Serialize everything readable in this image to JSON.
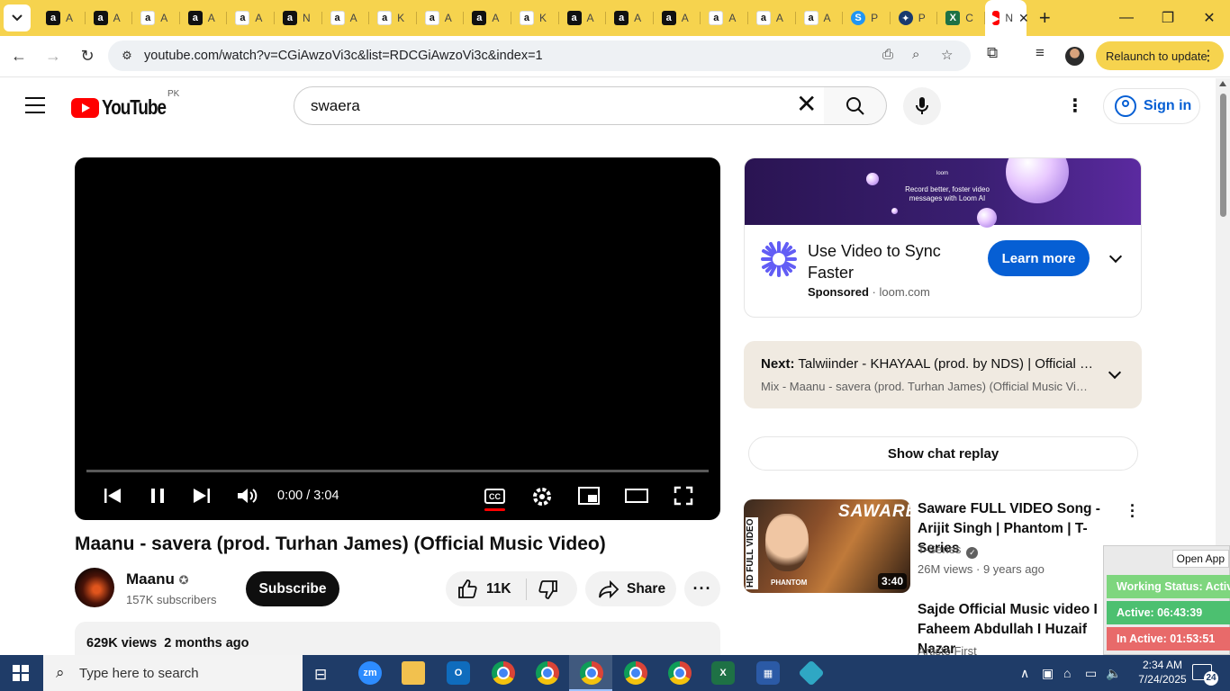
{
  "browser": {
    "tabs": [
      {
        "icon": "amazon-black",
        "label": "A"
      },
      {
        "icon": "amazon-black",
        "label": "A"
      },
      {
        "icon": "amazon-white",
        "label": "A"
      },
      {
        "icon": "amazon-black",
        "label": "A"
      },
      {
        "icon": "amazon-white",
        "label": "A"
      },
      {
        "icon": "amazon-black",
        "label": "N"
      },
      {
        "icon": "amazon-white",
        "label": "A"
      },
      {
        "icon": "amazon-white",
        "label": "K"
      },
      {
        "icon": "amazon-white",
        "label": "A"
      },
      {
        "icon": "amazon-black",
        "label": "A"
      },
      {
        "icon": "amazon-white",
        "label": "K"
      },
      {
        "icon": "amazon-black",
        "label": "A"
      },
      {
        "icon": "amazon-black",
        "label": "A"
      },
      {
        "icon": "amazon-black",
        "label": "A"
      },
      {
        "icon": "amazon-white",
        "label": "A"
      },
      {
        "icon": "amazon-white",
        "label": "A"
      },
      {
        "icon": "amazon-white",
        "label": "A"
      },
      {
        "icon": "skype-blue",
        "label": "P"
      },
      {
        "icon": "app-navy",
        "label": "P"
      },
      {
        "icon": "excel-green",
        "label": "C"
      }
    ],
    "active_tab": {
      "label": "N",
      "close": "✕"
    },
    "new_tab": "+",
    "url": "youtube.com/watch?v=CGiAwzoVi3c&list=RDCGiAwzoVi3c&index=1",
    "relaunch_label": "Relaunch to update"
  },
  "youtube": {
    "logo_text": "YouTube",
    "country": "PK",
    "search_value": "swaera",
    "sign_in": "Sign in"
  },
  "player": {
    "time": "0:00 / 3:04",
    "cc_label": "CC"
  },
  "video": {
    "title": "Maanu - savera (prod. Turhan James) (Official Music Video)",
    "channel": "Maanu",
    "subscribers": "157K subscribers",
    "subscribe_label": "Subscribe",
    "likes": "11K",
    "share_label": "Share",
    "views": "629K views",
    "age": "2 months ago"
  },
  "ad": {
    "banner_tag": "loom",
    "banner_text": "Record better, foster video messages with Loom AI",
    "title": "Use Video to Sync Faster",
    "sponsored": "Sponsored",
    "domain": "loom.com",
    "cta": "Learn more"
  },
  "next": {
    "label": "Next:",
    "title": "Talwiinder - KHAYAAL (prod. by NDS) | Official Music Video",
    "mix": "Mix - Maanu - savera (prod. Turhan James) (Official Music Video)"
  },
  "chat_replay": "Show chat replay",
  "related": [
    {
      "title": "Saware FULL VIDEO Song - Arijit Singh | Phantom | T-Series",
      "channel": "T-Series",
      "stats": "26M views · 9 years ago",
      "duration": "3:40",
      "thumb_text": "SAWARE",
      "thumb_side": "HD FULL VIDEO",
      "thumb_brand": "PHANTOM"
    },
    {
      "title": "Sajde Official Music video I Faheem Abdullah I Huzaif Nazar",
      "channel": "Artiste First"
    }
  ],
  "overlay": {
    "open_app": "Open App",
    "working_status": "Working Status: Active",
    "active": "Active: 06:43:39",
    "inactive": "In Active: 01:53:51",
    "colors": {
      "working": "#7ed67e",
      "active": "#4cc070",
      "inactive": "#e86a6a"
    }
  },
  "taskbar": {
    "search_placeholder": "Type here to search",
    "time": "2:34 AM",
    "date": "7/24/2025",
    "notifications": "24"
  }
}
